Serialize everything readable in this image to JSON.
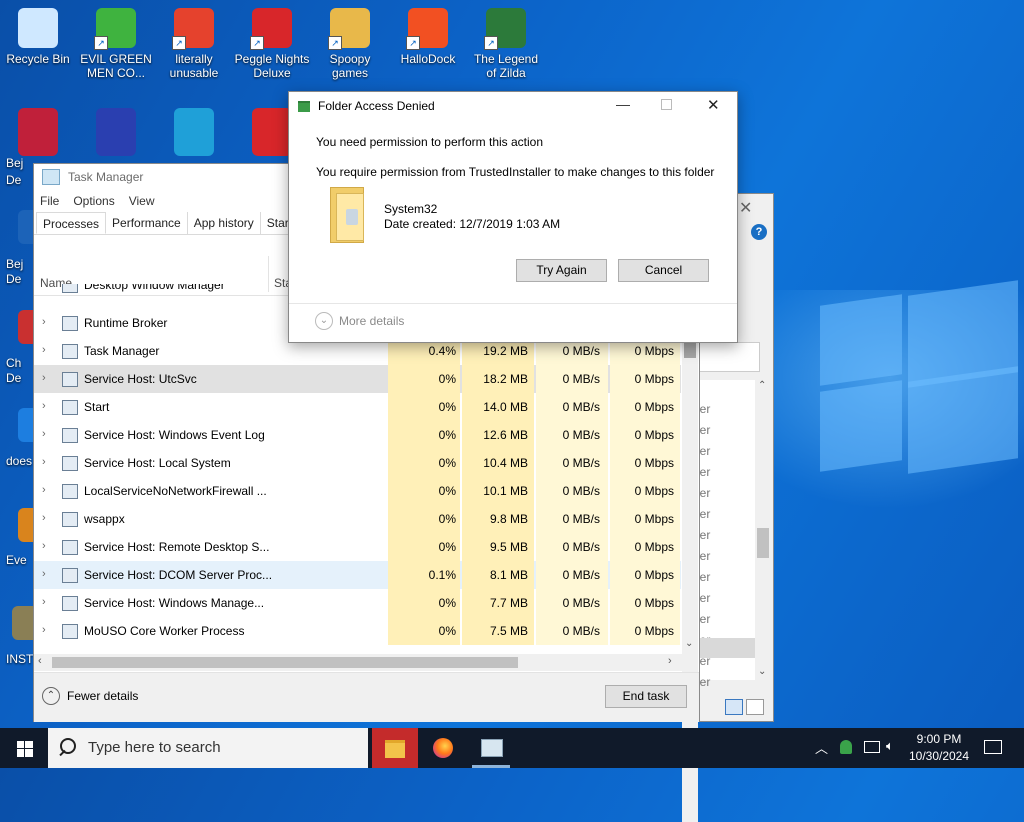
{
  "desktop": {
    "icons_top": [
      {
        "label": "Recycle Bin",
        "icon": "recycle-bin-icon",
        "color": "#cfe8ff"
      },
      {
        "label": "EVIL GREEN MEN CO...",
        "icon": "green-men-icon",
        "color": "#3fb33f"
      },
      {
        "label": "literally unusable",
        "icon": "chrome-icon",
        "color": "#e5422d"
      },
      {
        "label": "Peggle Nights Deluxe",
        "icon": "peggle-icon",
        "color": "#d8262a"
      },
      {
        "label": "Spoopy games",
        "icon": "folder-icon",
        "color": "#e8b84a"
      },
      {
        "label": "HalloDock",
        "icon": "windows-shield-icon",
        "color": "#f25022"
      },
      {
        "label": "The Legend of Zilda",
        "icon": "zilda-icon",
        "color": "#2c7a3a"
      }
    ],
    "icons_row2": [
      {
        "icon": "bejeweled-icon",
        "color": "#c0203a"
      },
      {
        "icon": "mpi-icon",
        "color": "#2a3fb0"
      },
      {
        "icon": "edge-icon",
        "color": "#1fa0d8"
      },
      {
        "icon": "peggle-icon",
        "color": "#d8262a"
      }
    ],
    "partial_left_labels": [
      "Bej",
      "De",
      "Bej",
      "De",
      "Ch",
      "De",
      "does",
      "Eve",
      "INST"
    ]
  },
  "task_manager": {
    "title": "Task Manager",
    "menu": [
      "File",
      "Options",
      "View"
    ],
    "tabs": [
      "Processes",
      "Performance",
      "App history",
      "Startu"
    ],
    "columns": {
      "name": "Name",
      "status": "Sta"
    },
    "top_partial_row": "Desktop Window Manager",
    "rows": [
      {
        "name": "Runtime Broker",
        "cpu": "",
        "mem": "",
        "disk": "",
        "net": "",
        "selected": false
      },
      {
        "name": "Task Manager",
        "cpu": "0.4%",
        "mem": "19.2 MB",
        "disk": "0 MB/s",
        "net": "0 Mbps",
        "selected": false
      },
      {
        "name": "Service Host: UtcSvc",
        "cpu": "0%",
        "mem": "18.2 MB",
        "disk": "0 MB/s",
        "net": "0 Mbps",
        "selected": true
      },
      {
        "name": "Start",
        "cpu": "0%",
        "mem": "14.0 MB",
        "disk": "0 MB/s",
        "net": "0 Mbps",
        "selected": false
      },
      {
        "name": "Service Host: Windows Event Log",
        "cpu": "0%",
        "mem": "12.6 MB",
        "disk": "0 MB/s",
        "net": "0 Mbps",
        "selected": false
      },
      {
        "name": "Service Host: Local System",
        "cpu": "0%",
        "mem": "10.4 MB",
        "disk": "0 MB/s",
        "net": "0 Mbps",
        "selected": false
      },
      {
        "name": "LocalServiceNoNetworkFirewall ...",
        "cpu": "0%",
        "mem": "10.1 MB",
        "disk": "0 MB/s",
        "net": "0 Mbps",
        "selected": false
      },
      {
        "name": "wsappx",
        "cpu": "0%",
        "mem": "9.8 MB",
        "disk": "0 MB/s",
        "net": "0 Mbps",
        "selected": false
      },
      {
        "name": "Service Host: Remote Desktop S...",
        "cpu": "0%",
        "mem": "9.5 MB",
        "disk": "0 MB/s",
        "net": "0 Mbps",
        "selected": false
      },
      {
        "name": "Service Host: DCOM Server Proc...",
        "cpu": "0.1%",
        "mem": "8.1 MB",
        "disk": "0 MB/s",
        "net": "0 Mbps",
        "selected": false,
        "hover": true
      },
      {
        "name": "Service Host: Windows Manage...",
        "cpu": "0%",
        "mem": "7.7 MB",
        "disk": "0 MB/s",
        "net": "0 Mbps",
        "selected": false
      },
      {
        "name": "MoUSO Core Worker Process",
        "cpu": "0%",
        "mem": "7.5 MB",
        "disk": "0 MB/s",
        "net": "0 Mbps",
        "selected": false
      }
    ],
    "fewer_details": "Fewer details",
    "end_task": "End task"
  },
  "bg_window": {
    "partial_text": [
      "ler",
      "ler",
      "ler",
      "ler",
      "ler",
      "ler",
      "ler",
      "ler",
      "ler",
      "ler",
      "ler",
      "ler",
      "ler",
      "ler"
    ]
  },
  "dialog": {
    "title": "Folder Access Denied",
    "heading": "You need permission to perform this action",
    "message": "You require permission from TrustedInstaller to make changes to this folder",
    "item_name": "System32",
    "item_date": "Date created: 12/7/2019 1:03 AM",
    "try_again": "Try Again",
    "cancel": "Cancel",
    "more_details": "More details"
  },
  "taskbar": {
    "search_placeholder": "Type here to search",
    "time": "9:00 PM",
    "date": "10/30/2024"
  },
  "colors": {
    "heat_light": "#fff8d6",
    "heat_mid": "#fff0b8",
    "selected_row": "#e1e1e1",
    "hover_row": "#e5f1fb",
    "taskbar": "#101a2a"
  }
}
